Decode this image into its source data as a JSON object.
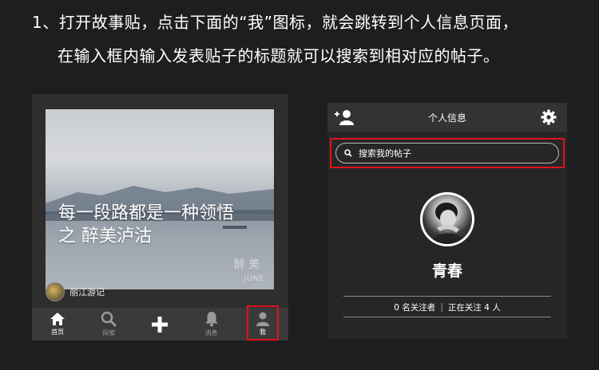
{
  "instructions": {
    "line1": "1、打开故事贴，点击下面的“我”图标，就会跳转到个人信息页面，",
    "line2": "在输入框内输入发表贴子的标题就可以搜索到相对应的帖子。"
  },
  "feed": {
    "hero_line1": "每一段路都是一种领悟",
    "hero_line2": "之 醉美泸沽",
    "signature": "醉美",
    "signature_sub": "JUNE",
    "account_name": "丽江游记"
  },
  "tabbar": {
    "items": [
      {
        "label": "首页",
        "icon": "home-icon",
        "active": true
      },
      {
        "label": "探索",
        "icon": "search-icon",
        "active": false
      },
      {
        "label": "",
        "icon": "plus-icon",
        "active": false
      },
      {
        "label": "消息",
        "icon": "bell-icon",
        "active": false
      },
      {
        "label": "我",
        "icon": "person-icon",
        "active": false
      }
    ],
    "highlight_color": "#e0121b"
  },
  "profile": {
    "title": "个人信息",
    "search_placeholder": "搜索我的帖子",
    "name": "青春",
    "followers": "0 名关注者",
    "following": "正在关注 4 人",
    "highlight_color": "#e0121b"
  }
}
